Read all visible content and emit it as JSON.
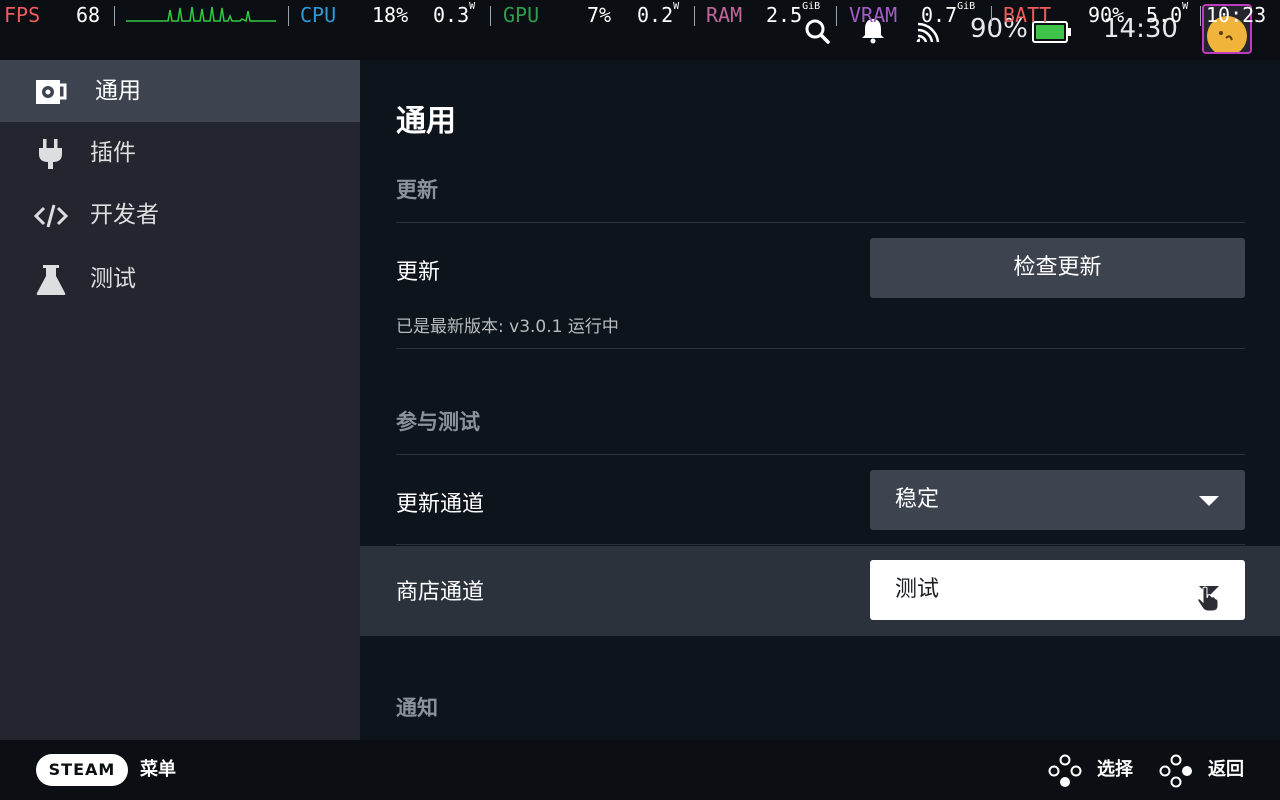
{
  "perf_overlay": {
    "fps_label": "FPS",
    "fps_value": "68",
    "cpu_label": "CPU",
    "cpu_percent": "18%",
    "cpu_watts": "0.3",
    "cpu_watts_unit": "W",
    "gpu_label": "GPU",
    "gpu_percent": "7%",
    "gpu_watts": "0.2",
    "gpu_watts_unit": "W",
    "ram_label": "RAM",
    "ram_value": "2.5",
    "ram_unit": "GiB",
    "vram_label": "VRAM",
    "vram_value": "0.7",
    "vram_unit": "GiB",
    "batt_label": "BATT",
    "batt_percent": "90%",
    "batt_watts": "5.0",
    "batt_watts_unit": "W",
    "clock": "10:23",
    "colors": {
      "fps": "#f05b5b",
      "cpu": "#2d9ad8",
      "gpu": "#2e9e4e",
      "ram": "#c2679a",
      "vram": "#a35cc4",
      "batt": "#f05b5b",
      "graph": "#2ecc40"
    }
  },
  "status_bar": {
    "icons": [
      "search-icon",
      "bell-icon",
      "wifi-icon",
      "battery-icon",
      "avatar"
    ],
    "battery_percent": "90%",
    "time": "14:30"
  },
  "sidebar": {
    "items": [
      {
        "label": "通用",
        "icon": "plugin-store-icon",
        "active": true
      },
      {
        "label": "插件",
        "icon": "plug-icon",
        "active": false
      },
      {
        "label": "开发者",
        "icon": "code-icon",
        "active": false
      },
      {
        "label": "测试",
        "icon": "flask-icon",
        "active": false
      }
    ]
  },
  "main": {
    "title": "通用",
    "sections": {
      "updates": {
        "title": "更新",
        "row_label": "更新",
        "button_label": "检查更新",
        "description": "已是最新版本: v3.0.1 运行中"
      },
      "testing": {
        "title": "参与测试",
        "update_channel": {
          "label": "更新通道",
          "value": "稳定"
        },
        "store_channel": {
          "label": "商店通道",
          "value": "测试"
        }
      },
      "notifications": {
        "title": "通知"
      }
    }
  },
  "footer": {
    "steam_label": "STEAM",
    "menu_label": "菜单",
    "select_label": "选择",
    "back_label": "返回"
  }
}
